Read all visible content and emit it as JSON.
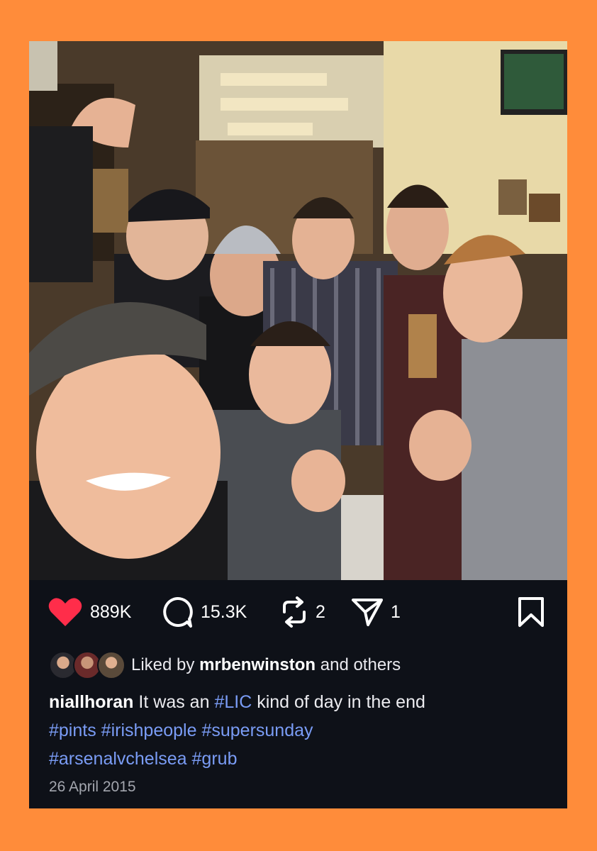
{
  "post": {
    "photo_label": "group selfie in a pub",
    "likes": "889K",
    "comments": "15.3K",
    "reposts": "2",
    "shares": "1",
    "liked_by_prefix": "Liked by",
    "liked_by_user": "mrbenwinston",
    "liked_by_suffix": "and others",
    "author": "niallhoran",
    "caption_text": "It was an",
    "caption_tag_1": "#LIC",
    "caption_text_2": "kind of day in the end",
    "hashtags": [
      "#pints",
      "#irishpeople",
      "#supersunday",
      "#arsenalvchelsea",
      "#grub"
    ],
    "date": "26 April 2015"
  },
  "colors": {
    "background": "#ff8c3a",
    "card": "#0e1118",
    "like": "#ff2d4a",
    "hashtag": "#7a9cf5"
  },
  "icons": {
    "like": "heart-icon",
    "comment": "comment-bubble-icon",
    "repost": "repost-icon",
    "share": "send-icon",
    "save": "bookmark-icon"
  }
}
